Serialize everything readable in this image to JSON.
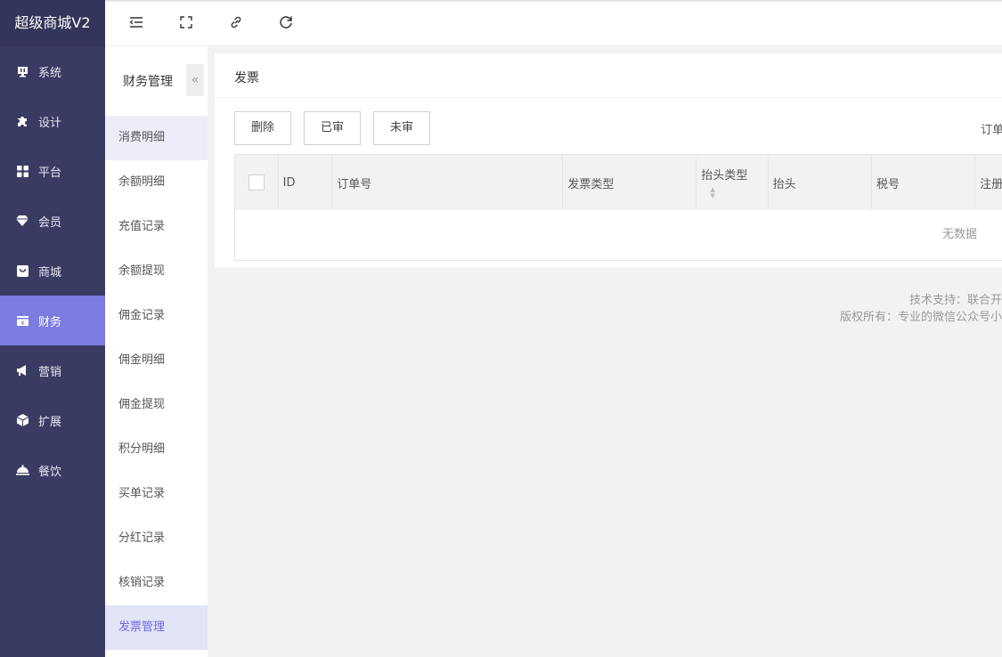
{
  "brand": "超级商城V2",
  "main_nav": [
    {
      "label": "系统",
      "icon": "system-icon"
    },
    {
      "label": "设计",
      "icon": "puzzle-icon"
    },
    {
      "label": "平台",
      "icon": "grid-icon"
    },
    {
      "label": "会员",
      "icon": "diamond-icon"
    },
    {
      "label": "商城",
      "icon": "bag-icon"
    },
    {
      "label": "财务",
      "icon": "cash-icon",
      "active": true
    },
    {
      "label": "营销",
      "icon": "megaphone-icon"
    },
    {
      "label": "扩展",
      "icon": "cube-icon"
    },
    {
      "label": "餐饮",
      "icon": "dish-icon"
    }
  ],
  "sub_nav": {
    "title": "财务管理",
    "collapse": "«",
    "items": [
      "消费明细",
      "余额明细",
      "充值记录",
      "余额提现",
      "佣金记录",
      "佣金明细",
      "佣金提现",
      "积分明细",
      "买单记录",
      "分红记录",
      "核销记录",
      "发票管理"
    ]
  },
  "card": {
    "title": "发票",
    "buttons": [
      "删除",
      "已审",
      "未审"
    ],
    "order_label": "订单"
  },
  "table": {
    "columns": [
      "ID",
      "订单号",
      "发票类型",
      "抬头类型",
      "抬头",
      "税号",
      "注册"
    ],
    "empty": "无数据"
  },
  "footer": {
    "line1": "技术支持：联合开",
    "line2": "版权所有：专业的微信公众号小"
  },
  "colors": {
    "sidebar": "#3a3b63",
    "accent": "#7b7be0"
  }
}
